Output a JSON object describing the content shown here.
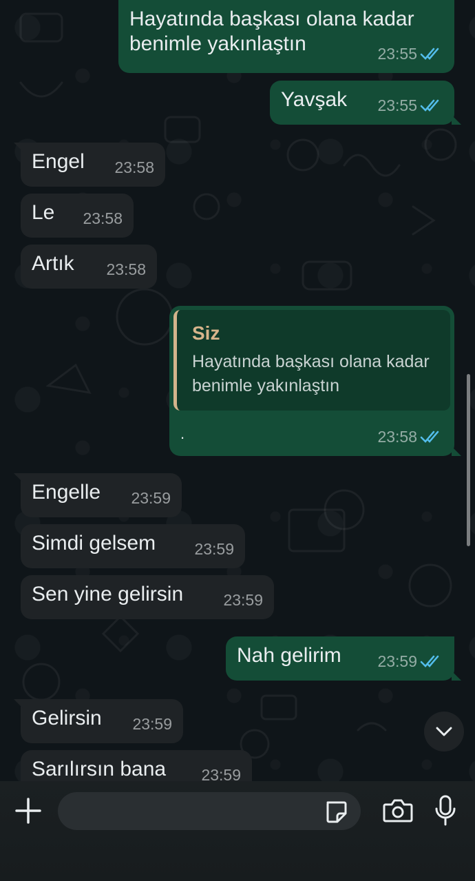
{
  "messages": [
    {
      "dir": "out",
      "text": "Hayatında başkası olana kadar\nbenimle yakınlaştın",
      "time": "23:55",
      "read": true
    },
    {
      "dir": "out",
      "text": "Yavşak",
      "time": "23:55",
      "read": true
    },
    {
      "dir": "in",
      "text": "Engel",
      "time": "23:58"
    },
    {
      "dir": "in",
      "text": "Le",
      "time": "23:58"
    },
    {
      "dir": "in",
      "text": "Artık",
      "time": "23:58"
    },
    {
      "dir": "out",
      "quote_author": "Siz",
      "quote_text": "Hayatında başkası olana kadar\nbenimle yakınlaştın",
      "text": ".",
      "time": "23:58",
      "read": true
    },
    {
      "dir": "in",
      "text": "Engelle",
      "time": "23:59"
    },
    {
      "dir": "in",
      "text": "Simdi gelsem",
      "time": "23:59"
    },
    {
      "dir": "in",
      "text": "Sen yine gelirsin",
      "time": "23:59"
    },
    {
      "dir": "out",
      "text": "Nah gelirim",
      "time": "23:59",
      "read": true
    },
    {
      "dir": "in",
      "text": "Gelirsin",
      "time": "23:59"
    },
    {
      "dir": "in",
      "text": "Sarılırsın bana",
      "time": "23:59"
    }
  ],
  "composer": {
    "placeholder": ""
  },
  "icons": {
    "attach": "plus-icon",
    "sticker": "sticker-icon",
    "camera": "camera-icon",
    "mic": "microphone-icon",
    "scroll": "chevron-down-icon",
    "read": "double-check-icon"
  },
  "colors": {
    "background": "#0b1014",
    "incoming_bubble": "#1f2326",
    "outgoing_bubble": "#144d37",
    "read_ticks": "#53bdeb",
    "quote_author": "#d7b48b"
  }
}
